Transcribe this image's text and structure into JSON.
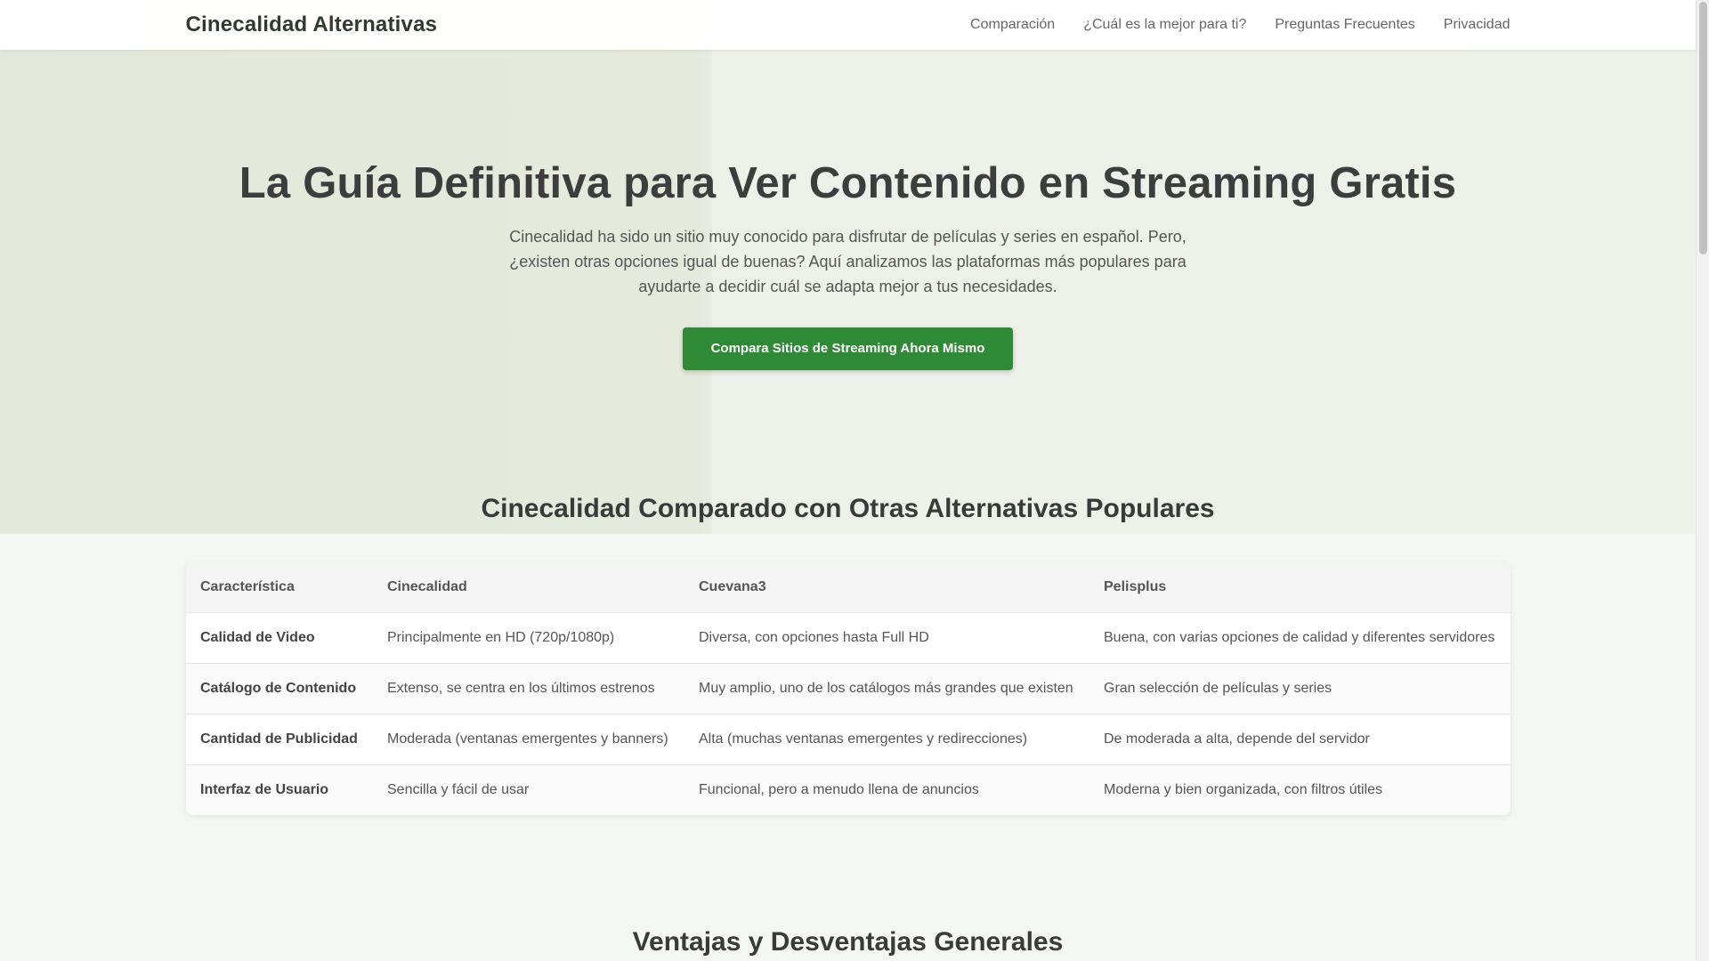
{
  "header": {
    "logo": "Cinecalidad Alternativas",
    "nav": [
      {
        "label": "Comparación"
      },
      {
        "label": "¿Cuál es la mejor para ti?"
      },
      {
        "label": "Preguntas Frecuentes"
      },
      {
        "label": "Privacidad"
      }
    ]
  },
  "hero": {
    "title": "La Guía Definitiva para Ver Contenido en Streaming Gratis",
    "description": "Cinecalidad ha sido un sitio muy conocido para disfrutar de películas y series en español. Pero, ¿existen otras opciones igual de buenas? Aquí analizamos las plataformas más populares para ayudarte a decidir cuál se adapta mejor a tus necesidades.",
    "cta_label": "Compara Sitios de Streaming Ahora Mismo"
  },
  "comparison": {
    "title": "Cinecalidad Comparado con Otras Alternativas Populares",
    "headers": [
      "Característica",
      "Cinecalidad",
      "Cuevana3",
      "Pelisplus"
    ],
    "rows": [
      [
        "Calidad de Video",
        "Principalmente en HD (720p/1080p)",
        "Diversa, con opciones hasta Full HD",
        "Buena, con varias opciones de calidad y diferentes servidores"
      ],
      [
        "Catálogo de Contenido",
        "Extenso, se centra en los últimos estrenos",
        "Muy amplio, uno de los catálogos más grandes que existen",
        "Gran selección de películas y series"
      ],
      [
        "Cantidad de Publicidad",
        "Moderada (ventanas emergentes y banners)",
        "Alta (muchas ventanas emergentes y redirecciones)",
        "De moderada a alta, depende del servidor"
      ],
      [
        "Interfaz de Usuario",
        "Sencilla y fácil de usar",
        "Funcional, pero a menudo llena de anuncios",
        "Moderna y bien organizada, con filtros útiles"
      ]
    ]
  },
  "pros_cons": {
    "title": "Ventajas y Desventajas Generales"
  },
  "colors": {
    "accent": "#2e8a35",
    "background": "#f5f7f4"
  }
}
